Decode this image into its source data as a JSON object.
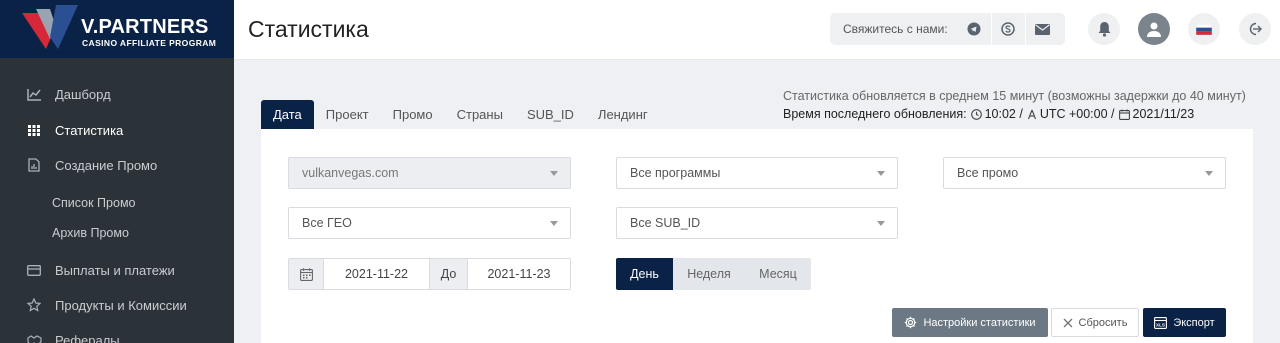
{
  "brand": {
    "name": "V.PARTNERS",
    "tagline": "CASINO AFFILIATE PROGRAM"
  },
  "colors": {
    "sidebar_bg": "#2b3339",
    "brand_navy": "#0b2247",
    "logo_red": "#d62839"
  },
  "sidebar": {
    "items": [
      {
        "label": "Дашборд",
        "icon": "chart-line-icon"
      },
      {
        "label": "Статистика",
        "icon": "grid-icon",
        "active": true
      },
      {
        "label": "Создание Промо",
        "icon": "document-chart-icon"
      },
      {
        "label": "Список Промо"
      },
      {
        "label": "Архив Промо"
      },
      {
        "label": "Выплаты и платежи",
        "icon": "credit-card-icon"
      },
      {
        "label": "Продукты и Комиссии",
        "icon": "star-icon"
      },
      {
        "label": "Рефералы",
        "icon": "handshake-icon"
      }
    ]
  },
  "header": {
    "title": "Статистика",
    "contact_label": "Свяжитесь с нами:",
    "language": "ru"
  },
  "info": {
    "update_note": "Статистика обновляется в среднем 15 минут (возможны задержки до 40 минут)",
    "last_update_label": "Время последнего обновления:",
    "time": "10:02 /",
    "timezone": "UTC +00:00 /",
    "date": "2021/11/23"
  },
  "tabs": [
    "Дата",
    "Проект",
    "Промо",
    "Страны",
    "SUB_ID",
    "Лендинг"
  ],
  "filters": {
    "site": "vulkanvegas.com",
    "programs": "Все программы",
    "promo": "Все промо",
    "geo": "Все ГЕО",
    "sub_id": "Все SUB_ID",
    "date_from": "2021-11-22",
    "to_label": "До",
    "date_to": "2021-11-23"
  },
  "period": {
    "options": [
      "День",
      "Неделя",
      "Месяц"
    ],
    "selected": "День"
  },
  "actions": {
    "settings": "Настройки статистики",
    "reset": "Сбросить",
    "export": "Экспорт"
  }
}
